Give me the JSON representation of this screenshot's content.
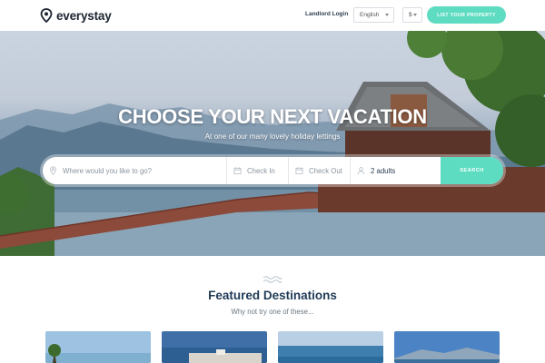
{
  "header": {
    "brand": "everystay",
    "landlord_login": "Landlord Login",
    "language": "English",
    "currency": "$",
    "cta": "LIST YOUR PROPERTY"
  },
  "hero": {
    "title": "CHOOSE YOUR NEXT VACATION",
    "subtitle": "At one of our many lovely holiday lettings"
  },
  "search": {
    "where_placeholder": "Where would you like to go?",
    "check_in": "Check In",
    "check_out": "Check Out",
    "guests": "2 adults",
    "button": "SEARCH"
  },
  "featured": {
    "title": "Featured Destinations",
    "subtitle": "Why not try one of these...",
    "cards": [
      {
        "image": "tropical-palm-photo"
      },
      {
        "image": "coastal-town-photo"
      },
      {
        "image": "sea-horizon-photo"
      },
      {
        "image": "mountain-bay-photo"
      }
    ]
  },
  "colors": {
    "accent": "#5ddcc1",
    "heading": "#1f3a56"
  },
  "icons": {
    "logo": "location-pin-icon",
    "where": "map-pin-icon",
    "check_in": "calendar-icon",
    "check_out": "calendar-icon",
    "guests": "person-icon",
    "divider": "wave-icon"
  }
}
